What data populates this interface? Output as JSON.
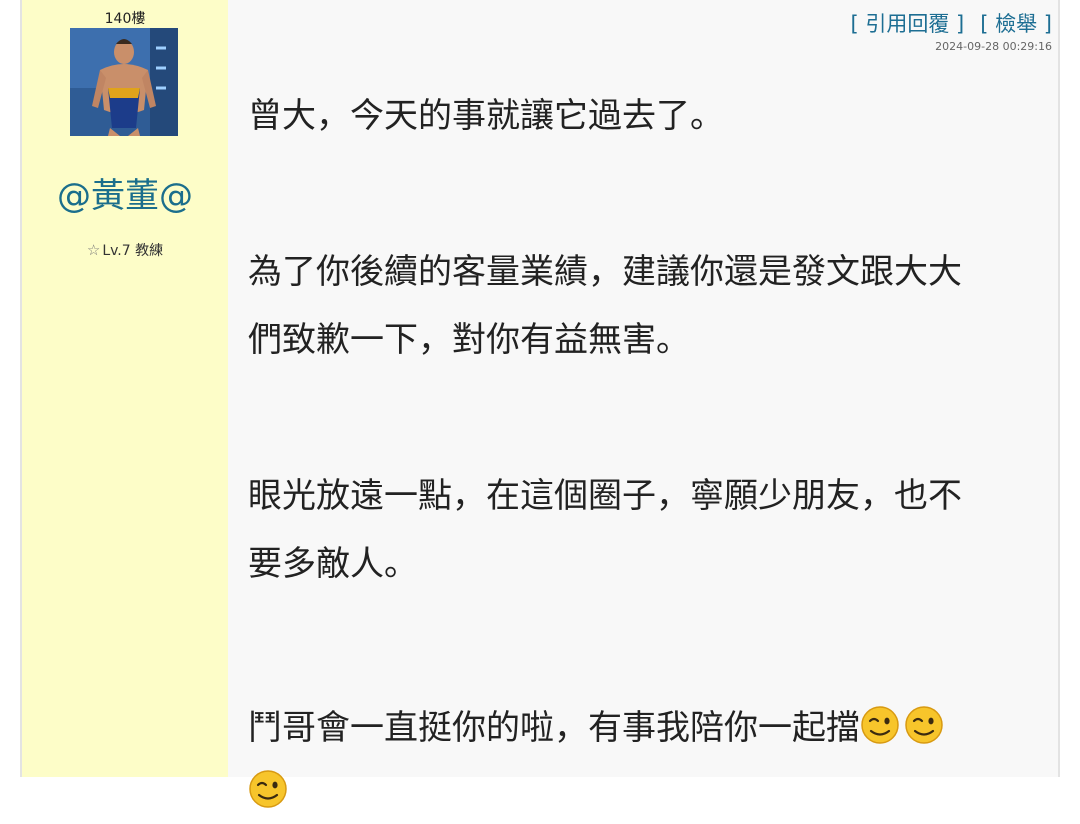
{
  "post": {
    "floor": "140樓",
    "username": "@黃董@",
    "level": "Lv.7 教練",
    "quote_reply_label": "引用回覆",
    "report_label": "檢舉",
    "timestamp": "2024-09-28 00:29:16",
    "paragraphs": [
      "曾大，今天的事就讓它過去了。",
      "為了你後續的客量業績，建議你還是發文跟大大",
      "們致歉一下，對你有益無害。",
      "眼光放遠一點，在這個圈子，寧願少朋友，也不",
      "要多敵人。",
      "鬥哥會一直挺你的啦，有事我陪你一起擋"
    ],
    "emoji": "winking-face-icon"
  },
  "colors": {
    "sidebar_bg": "#fdfdc8",
    "username": "#1b6e8c",
    "link": "#1d6e93"
  }
}
